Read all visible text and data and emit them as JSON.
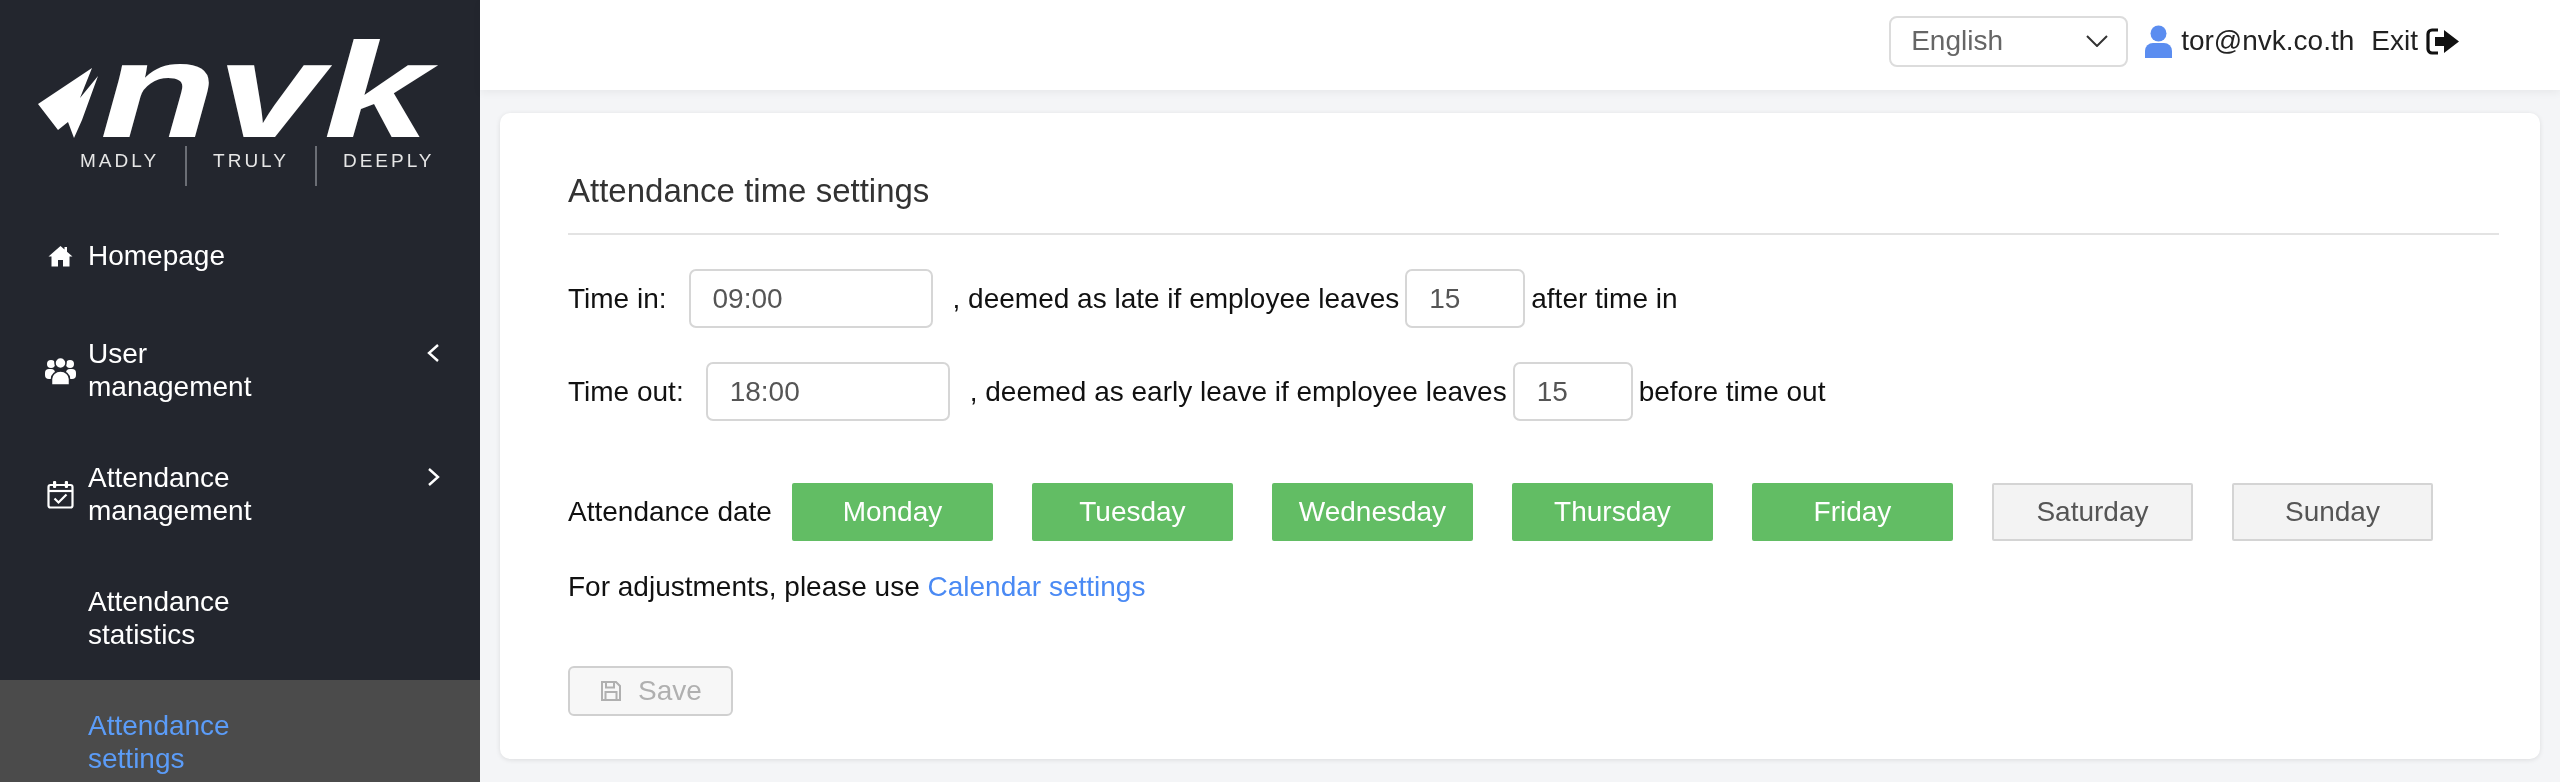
{
  "logo": {
    "wordmark": "nvk",
    "taglines": [
      "MADLY",
      "TRULY",
      "DEEPLY"
    ]
  },
  "sidebar": {
    "items": [
      {
        "kind": "link",
        "label": "Homepage",
        "selected": false
      },
      {
        "kind": "group",
        "label": "User management",
        "expanded": false,
        "selected": false
      },
      {
        "kind": "group",
        "label": "Attendance management",
        "expanded": true,
        "selected": false,
        "children": [
          {
            "label": "Attendance statistics",
            "selected": false
          },
          {
            "label": "Attendance settings",
            "selected": true
          }
        ]
      }
    ]
  },
  "top_bar": {
    "language": "English",
    "user": "tor@nvk.co.th",
    "exit": "Exit"
  },
  "card": {
    "title": "Attendance time settings",
    "rows": [
      {
        "label": "Time in:",
        "time": "09:00",
        "text": ", deemed as late if employee leaves",
        "minutes": "15",
        "suffix": "after time in"
      },
      {
        "label": "Time out:",
        "time": "18:00",
        "text": ", deemed as early leave if employee leaves",
        "minutes": "15",
        "suffix": "before time out"
      }
    ],
    "attendance_date": {
      "label": "Attendance date",
      "days": [
        {
          "label": "Monday",
          "selected": true
        },
        {
          "label": "Tuesday",
          "selected": true
        },
        {
          "label": "Wednesday",
          "selected": true
        },
        {
          "label": "Thursday",
          "selected": true
        },
        {
          "label": "Friday",
          "selected": true
        },
        {
          "label": "Saturday",
          "selected": false
        },
        {
          "label": "Sunday",
          "selected": false
        }
      ]
    },
    "note": {
      "text": "For adjustments, please use",
      "link": "Calendar settings"
    },
    "save_button": {
      "label": "Save",
      "disabled": true
    }
  }
}
